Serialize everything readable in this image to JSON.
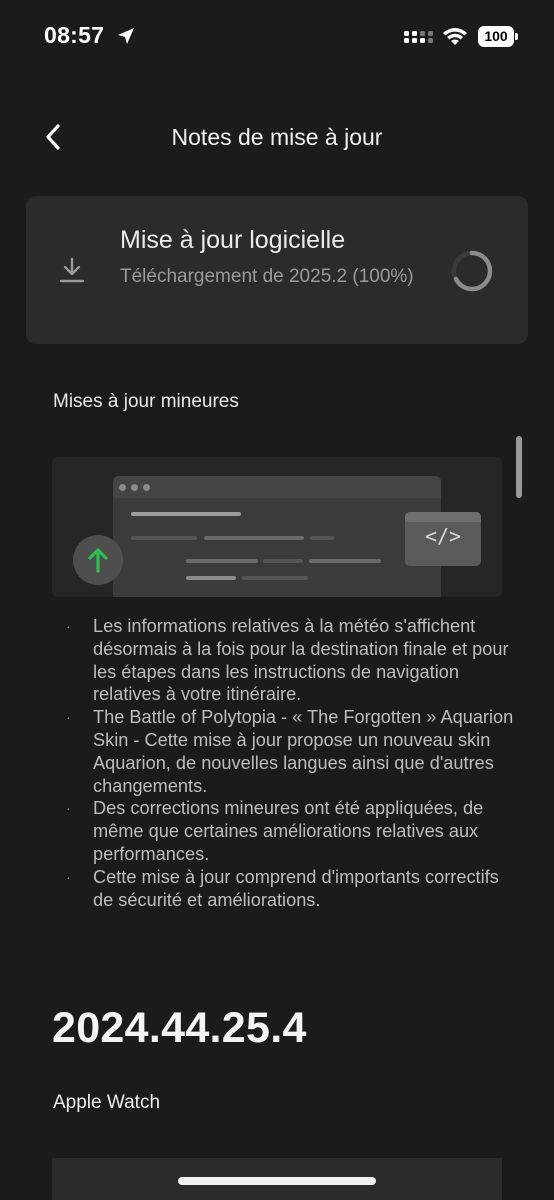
{
  "status_bar": {
    "time": "08:57",
    "battery": "100"
  },
  "header": {
    "title": "Notes de mise à jour"
  },
  "update_card": {
    "title": "Mise à jour logicielle",
    "subtitle": "Téléchargement de 2025.2 (100%)",
    "progress_percent": 100
  },
  "section": {
    "heading": "Mises à jour mineures"
  },
  "illustration": {
    "code_symbol": "</>"
  },
  "notes": [
    "Les informations relatives à la météo s'affichent désormais à la fois pour la destination finale et pour les étapes dans les instructions de navigation relatives à votre itinéraire.",
    "The Battle of Polytopia - « The Forgotten » Aquarion Skin - Cette mise à jour propose un nouveau skin Aquarion, de nouvelles langues ainsi que d'autres changements.",
    "Des corrections mineures ont été appliquées, de même que certaines améliorations relatives aux performances.",
    "Cette mise à jour comprend d'importants correctifs de sécurité et améliorations."
  ],
  "bullet_char": "·",
  "version": {
    "number": "2024.44.25.4",
    "subheading": "Apple Watch"
  },
  "colors": {
    "background": "#1b1b1b",
    "card": "#2b2b2b",
    "accent_green": "#2fbf4f"
  }
}
